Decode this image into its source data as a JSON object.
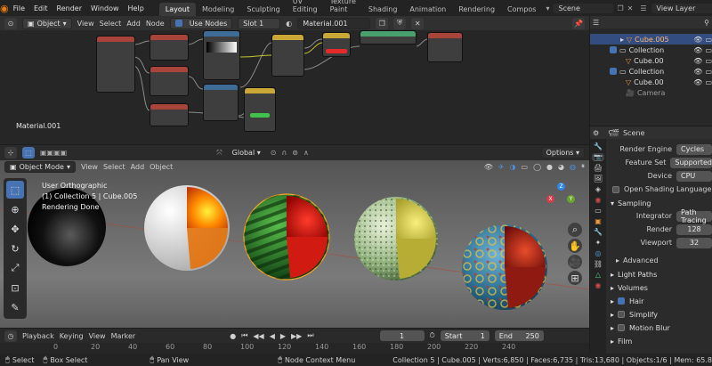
{
  "menus": [
    "File",
    "Edit",
    "Render",
    "Window",
    "Help"
  ],
  "workspaces": [
    "Layout",
    "Modeling",
    "Sculpting",
    "UV Editing",
    "Texture Paint",
    "Shading",
    "Animation",
    "Rendering",
    "Compos"
  ],
  "scene_name": "Scene",
  "view_layer": "View Layer",
  "node_editor": {
    "type": "Object",
    "menus": [
      "View",
      "Select",
      "Add",
      "Node"
    ],
    "use_nodes": "Use Nodes",
    "slot": "Slot 1",
    "material": "Material.001",
    "material_label": "Material.001"
  },
  "viewport": {
    "mode": "Object Mode",
    "menus": [
      "View",
      "Select",
      "Add",
      "Object"
    ],
    "orientation": "Global",
    "options": "Options",
    "info_lines": [
      "User Orthographic",
      "(1) Collection 5 | Cube.005",
      "Rendering Done"
    ]
  },
  "outliner": {
    "items": [
      "Cube.005",
      "Collection",
      "Cube.00",
      "Collection",
      "Cube.00",
      "Camera"
    ]
  },
  "properties": {
    "title": "Scene",
    "render_engine_label": "Render Engine",
    "render_engine": "Cycles",
    "feature_set_label": "Feature Set",
    "feature_set": "Supported",
    "device_label": "Device",
    "device": "CPU",
    "osl": "Open Shading Language",
    "sampling": "Sampling",
    "integrator_label": "Integrator",
    "integrator": "Path Tracing",
    "render_label": "Render",
    "render_samples": "128",
    "viewport_label": "Viewport",
    "viewport_samples": "32",
    "advanced": "Advanced",
    "panels": [
      "Light Paths",
      "Volumes",
      "Hair",
      "Simplify",
      "Motion Blur",
      "Film"
    ]
  },
  "timeline": {
    "menus": [
      "Playback",
      "Keying",
      "View",
      "Marker"
    ],
    "current_frame": "1",
    "start_label": "Start",
    "start": "1",
    "end_label": "End",
    "end": "250",
    "ticks": [
      "0",
      "20",
      "40",
      "60",
      "80",
      "100",
      "120",
      "140",
      "160",
      "180",
      "200",
      "220",
      "240"
    ]
  },
  "status": {
    "left": [
      "Select",
      "Box Select",
      "Pan View",
      "Node Context Menu"
    ],
    "right": "Collection 5 | Cube.005 | Verts:6,850 | Faces:6,735 | Tris:13,680 | Objects:1/6 | Mem: 65.8"
  }
}
